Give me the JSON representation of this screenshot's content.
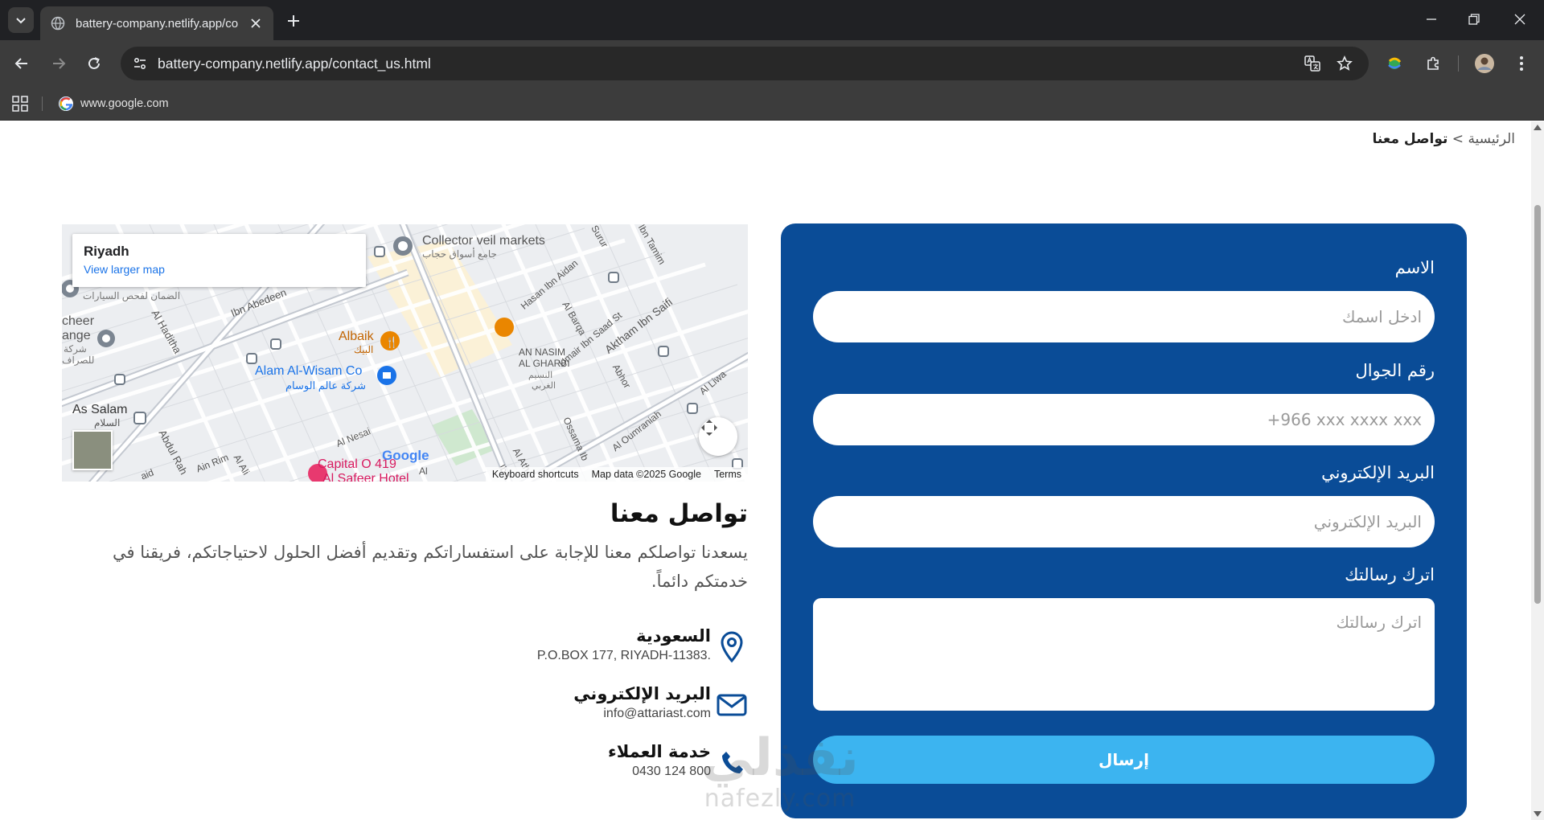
{
  "browser": {
    "tab_title": "battery-company.netlify.app/co",
    "url_host": "battery-company.netlify.app",
    "url_path": "/contact_us.html",
    "bookmark_label": "www.google.com"
  },
  "page": {
    "breadcrumb_home": "الرئيسية",
    "breadcrumb_sep": ">",
    "breadcrumb_current": "تواصل معنا"
  },
  "map": {
    "city": "Riyadh",
    "larger_map": "View larger map",
    "footer_shortcuts": "Keyboard shortcuts",
    "footer_data": "Map data ©2025 Google",
    "footer_terms": "Terms",
    "google_logo": "Google",
    "labels": {
      "collector": "Collector veil markets",
      "collector_ar": "جامع أسواق حجاب",
      "albaik": "Albaik",
      "albaik_ar": "البيك",
      "alam": "Alam Al-Wisam Co",
      "alam_ar": "شركة عالم الوسام",
      "an_nasim": "AN NASIM",
      "al_gharbi": "AL GHARBI",
      "an_nasim_ar": "النسيم",
      "al_gharbi_ar": "الغربي",
      "as_salam": "As Salam",
      "as_salam_ar": "السلام",
      "capital": "Capital O 419",
      "al_safeer": "Al Safeer Hotel",
      "cheer": "cheer",
      "ange": "ange",
      "sharika": "شركة",
      "lil_sarraf": "للصراف",
      "daman": "الضمان لفحص السيارات",
      "ibn_abedeen": "Ibn Abedeen",
      "al_haditha": "Al Haditha",
      "hasan": "Hasan Ibn Aidan",
      "al_barqa": "Al Barqa",
      "umair": "Umair Ibn Saad St",
      "aktham": "Aktham Ibn Saifi",
      "abhor": "Abhor",
      "al_liwa": "Al Liwa",
      "ibn_tamim": "Ibn Tamim",
      "surur": "Surur",
      "al_nesai": "Al Nesai",
      "ossama": "Ossama Ib",
      "al_oumraniah": "Al Oumraniah",
      "abdul_rah": "Abdul Rah",
      "ain_rim": "Ain Rim",
      "al_ali": "Al Ali",
      "al_ath": "Al Ath",
      "ibn": "Ibn",
      "aid": "aid",
      "al": "Al"
    }
  },
  "contact": {
    "heading": "تواصل معنا",
    "description": "يسعدنا تواصلكم معنا للإجابة على استفساراتكم وتقديم أفضل الحلول لاحتياجاتكم، فريقنا في خدمتكم دائماً.",
    "items": [
      {
        "title": "السعودية",
        "value": "P.O.BOX 177, RIYADH-11383.",
        "icon": "location-pin-icon"
      },
      {
        "title": "البريد الإلكتروني",
        "value": "info@attariast.com",
        "icon": "envelope-icon"
      },
      {
        "title": "خدمة العملاء",
        "value": "0430 124 800",
        "icon": "phone-icon"
      }
    ]
  },
  "form": {
    "name_label": "الاسم",
    "name_placeholder": "ادخل اسمك",
    "phone_label": "رقم الجوال",
    "phone_placeholder": "+966 xxx xxxx xxx",
    "email_label": "البريد الإلكتروني",
    "email_placeholder": "البريد الإلكتروني",
    "message_label": "اترك رسالتك",
    "message_placeholder": "اترك رسالتك",
    "submit_label": "إرسال"
  },
  "watermark": {
    "arabic": "نفذلي",
    "latin": "nafezly.com"
  },
  "colors": {
    "panel": "#0a4c97",
    "submit": "#3cb4f0",
    "icon_blue": "#0a4c97"
  }
}
